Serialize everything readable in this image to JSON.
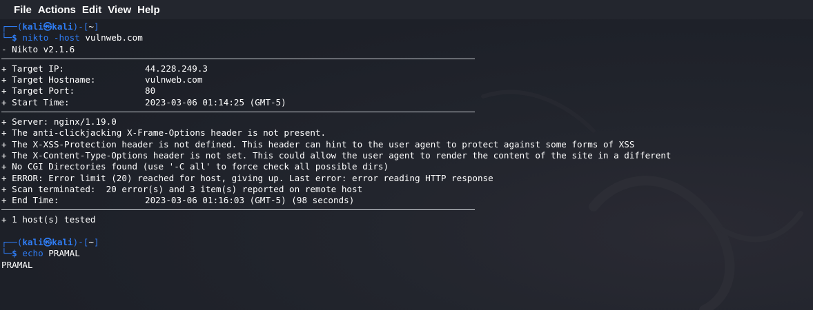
{
  "menubar": {
    "file": "File",
    "actions": "Actions",
    "edit": "Edit",
    "view": "View",
    "help": "Help"
  },
  "prompt": {
    "top_prefix": "┌──(",
    "user": "kali",
    "at": "㉿",
    "host": "kali",
    "dir_open": ")-[",
    "dir": "~",
    "dir_close": "]",
    "bottom_prefix": "└─",
    "dollar": "$"
  },
  "command1": {
    "name": "nikto",
    "option": "-host",
    "arg": "vulnweb.com"
  },
  "output": {
    "version": "- Nikto v2.1.6",
    "target_ip_key": "+ Target IP:",
    "target_ip_val": "44.228.249.3",
    "target_hostname_key": "+ Target Hostname:",
    "target_hostname_val": "vulnweb.com",
    "target_port_key": "+ Target Port:",
    "target_port_val": "80",
    "start_time_key": "+ Start Time:",
    "start_time_val": "2023-03-06 01:14:25 (GMT-5)",
    "server": "+ Server: nginx/1.19.0",
    "clickjacking": "+ The anti-clickjacking X-Frame-Options header is not present.",
    "xss": "+ The X-XSS-Protection header is not defined. This header can hint to the user agent to protect against some forms of XSS",
    "content_type": "+ The X-Content-Type-Options header is not set. This could allow the user agent to render the content of the site in a different",
    "cgi": "+ No CGI Directories found (use '-C all' to force check all possible dirs)",
    "error": "+ ERROR: Error limit (20) reached for host, giving up. Last error: error reading HTTP response",
    "scan_terminated": "+ Scan terminated:  20 error(s) and 3 item(s) reported on remote host",
    "end_time_key": "+ End Time:",
    "end_time_val": "2023-03-06 01:16:03 (GMT-5) (98 seconds)",
    "hosts_tested": "+ 1 host(s) tested"
  },
  "command2": {
    "name": "echo",
    "arg": "PRAMAL"
  },
  "echo_output": "PRAMAL",
  "colors": {
    "background": "#1e2129",
    "prompt_blue": "#2f7df6",
    "text": "#ffffff"
  }
}
